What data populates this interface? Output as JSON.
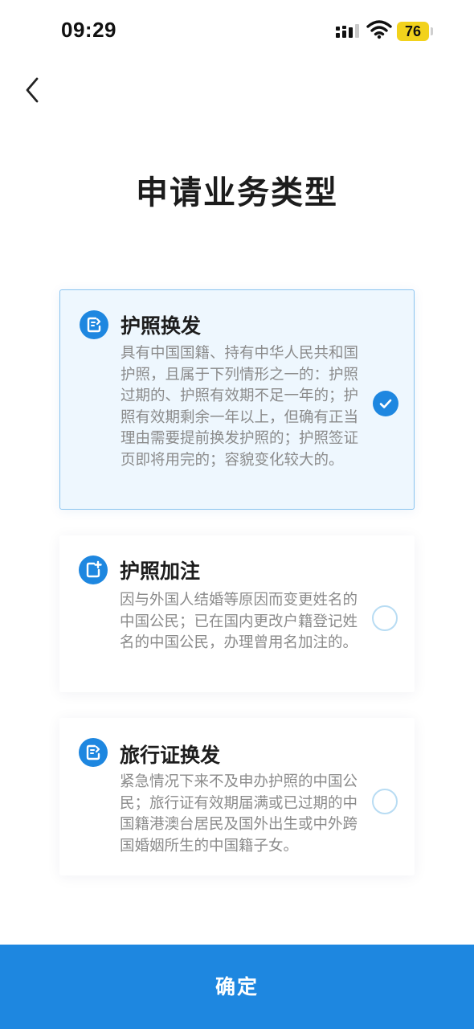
{
  "status_bar": {
    "time": "09:29",
    "battery": "76",
    "battery_color": "#f2d21c"
  },
  "header": {
    "back_icon": "chevron-left-icon"
  },
  "page": {
    "title": "申请业务类型"
  },
  "options": [
    {
      "title": "护照换发",
      "description": "具有中国国籍、持有中华人民共和国护照，且属于下列情形之一的：护照过期的、护照有效期不足一年的；护照有效期剩余一年以上，但确有正当理由需要提前换发护照的；护照签证页即将用完的；容貌变化较大的。",
      "icon": "renew-document-icon",
      "selected": true
    },
    {
      "title": "护照加注",
      "description": "因与外国人结婚等原因而变更姓名的中国公民；已在国内更改户籍登记姓名的中国公民，办理曾用名加注的。",
      "icon": "add-document-icon",
      "selected": false
    },
    {
      "title": "旅行证换发",
      "description": "紧急情况下来不及申办护照的中国公民；旅行证有效期届满或已过期的中国籍港澳台居民及国外出生或中外跨国婚姻所生的中国籍子女。",
      "icon": "renew-document-icon",
      "selected": false
    }
  ],
  "footer": {
    "confirm_label": "确定"
  },
  "colors": {
    "accent": "#1e87e0",
    "selected_background": "#eef7fe",
    "selected_border": "#8ac4f0"
  }
}
